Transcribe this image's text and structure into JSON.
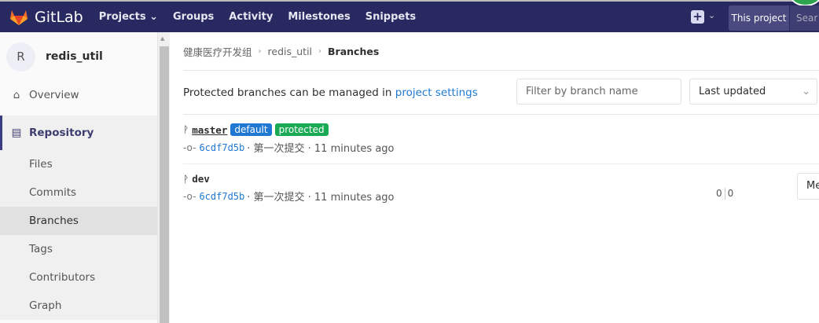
{
  "nav": {
    "brand": "GitLab",
    "items": [
      "Projects",
      "Groups",
      "Activity",
      "Milestones",
      "Snippets"
    ],
    "this_project": "This project",
    "search_placeholder": "Sear"
  },
  "sidebar": {
    "avatar_letter": "R",
    "project_name": "redis_util",
    "overview": "Overview",
    "repository": "Repository",
    "sub_items": [
      "Files",
      "Commits",
      "Branches",
      "Tags",
      "Contributors",
      "Graph"
    ],
    "active": "Branches"
  },
  "breadcrumb": [
    "健康医疗开发组",
    "redis_util",
    "Branches"
  ],
  "toolbar": {
    "text": "Protected branches can be managed in ",
    "link": "project settings",
    "filter_placeholder": "Filter by branch name",
    "sort": "Last updated"
  },
  "branches": [
    {
      "name": "master",
      "badges": [
        {
          "label": "default",
          "color": "#1f78d1"
        },
        {
          "label": "protected",
          "color": "#1aaa55"
        }
      ],
      "sha": "6cdf7d5b",
      "message": "· 第一次提交 · 11 minutes ago"
    },
    {
      "name": "dev",
      "sha": "6cdf7d5b",
      "message": "· 第一次提交 · 11 minutes ago",
      "behind": "0",
      "ahead": "0",
      "merge_label": "Me"
    }
  ]
}
